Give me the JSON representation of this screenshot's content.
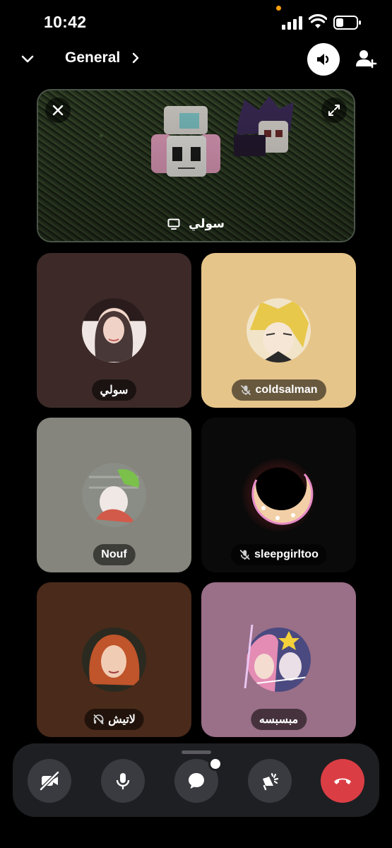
{
  "status_bar": {
    "time": "10:42",
    "icons": [
      "signal-icon",
      "wifi-icon",
      "battery-icon"
    ]
  },
  "header": {
    "channel_title": "General",
    "icons": [
      "chevron-down-icon",
      "chevron-right-icon",
      "speaker-icon",
      "add-user-icon"
    ]
  },
  "stream": {
    "streamer_name": "سولي",
    "icons": [
      "close-icon",
      "expand-icon",
      "screen-share-icon"
    ]
  },
  "participants": [
    {
      "name": "سولي",
      "muted": false,
      "tile_color": "#3d2a28"
    },
    {
      "name": "coldsalman",
      "muted": true,
      "tile_color": "#e6c58a"
    },
    {
      "name": "Nouf",
      "muted": false,
      "tile_color": "#85857d"
    },
    {
      "name": "sleepgirltoo",
      "muted": true,
      "tile_color": "#0a0a0a"
    },
    {
      "name": "لاتيش",
      "muted": true,
      "tile_color": "#4a2a1a"
    },
    {
      "name": "مبسبسه",
      "muted": false,
      "tile_color": "#9a6f88"
    }
  ],
  "controls": [
    {
      "name": "camera-off",
      "icon": "camera-off-icon"
    },
    {
      "name": "microphone",
      "icon": "microphone-icon"
    },
    {
      "name": "chat",
      "icon": "chat-icon"
    },
    {
      "name": "soundboard",
      "icon": "soundboard-icon"
    },
    {
      "name": "hang-up",
      "icon": "hang-up-icon"
    }
  ],
  "colors": {
    "background": "#000000",
    "bottom_bar": "#1e1f22",
    "control_button": "#3a3b40",
    "hangup": "#da3e44"
  }
}
